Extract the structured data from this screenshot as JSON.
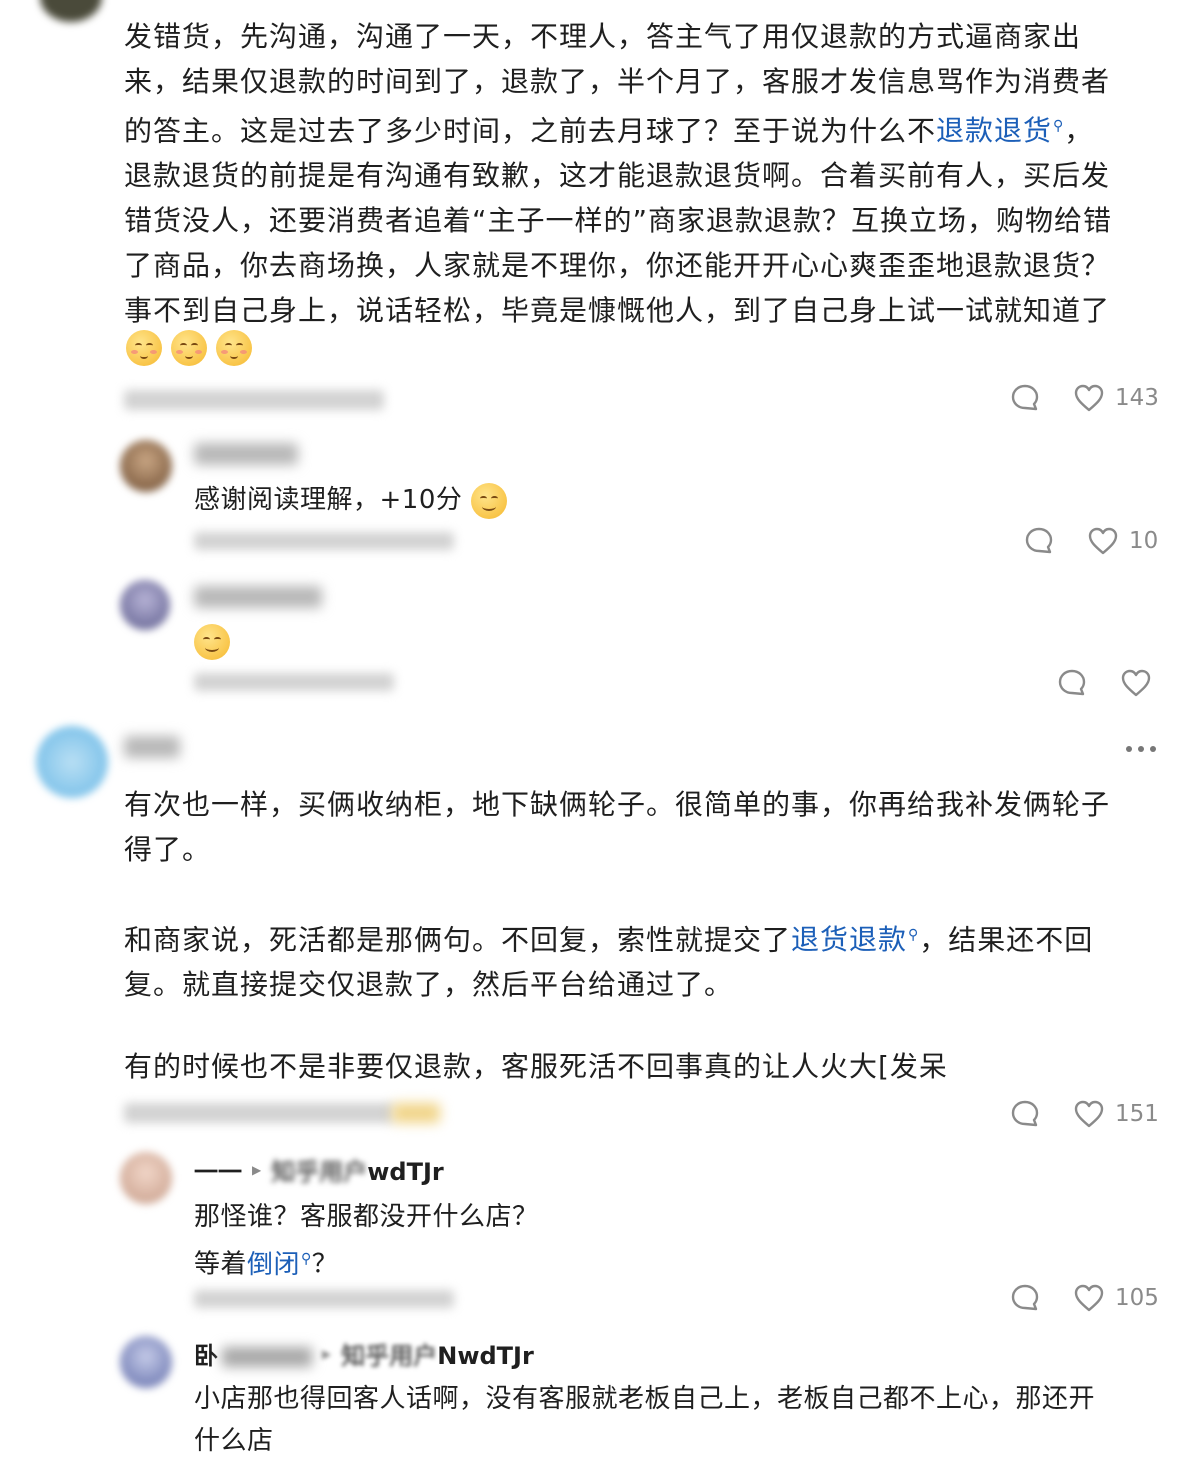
{
  "comments": [
    {
      "text_segments": [
        {
          "t": "发错货，先沟通，沟通了一天，不理人，答主气了用仅退款的方式逼商家出\n来，结果仅退款的时间到了，退款了，半个月了，客服才发信息骂作为消费者\n的答主。这是过去了多少时间，之前去月球了？至于说为什么不"
        },
        {
          "t": "退款退货",
          "link": true
        },
        {
          "t": "，\n退款退货的前提是有沟通有致歉，这才能退款退货啊。合着买前有人，买后发\n错货没人，还要消费者追着“主子一样的”商家退款退款？互换立场，购物给错\n了商品，你去商场换，人家就是不理你，你还能开开心心爽歪歪地退款退货？\n事不到自己身上，说话轻松，毕竟是慷慨他人，到了自己身上试一试就知道了"
        }
      ],
      "like_count": "143",
      "replies": [
        {
          "text": "感谢阅读理解，+10分",
          "meta_partial": "2022 12 03 · 广东",
          "like_count": "10"
        },
        {
          "text": "",
          "meta_partial": "2 5 7 · 广西",
          "like_count": ""
        }
      ]
    },
    {
      "text_para1": "有次也一样，买俩收纳柜，地下缺俩轮子。很简单的事，你再给我补发俩轮子\n得了。",
      "text_para2_a": "和商家说，死活都是那俩句。不回复，索性就提交了",
      "text_para2_link": "退货退款",
      "text_para2_b": "，结果还不回\n复。就直接提交仅退款了，然后平台给通过了。",
      "text_para3": "有的时候也不是非要仅退款，客服死活不回事真的让人火大[发呆",
      "like_count": "151",
      "replies": [
        {
          "author_prefix": "一一",
          "reply_to_visible": "知乎用户",
          "reply_to_suffix": "wdTJr",
          "text_line1": "那怪谁？客服都没开什么店？",
          "text_line2_a": "等着",
          "text_line2_link": "倒闭",
          "text_line2_b": "？",
          "like_count": "105"
        },
        {
          "author_prefix": "卧",
          "reply_to_visible": "知乎用户",
          "reply_to_suffix": "NwdTJr",
          "text": "小店那也得回客人话啊，没有客服就老板自己上，老板自己都不上心，那还开\n什么店"
        }
      ]
    }
  ],
  "icons": [
    "comment-icon",
    "heart-icon",
    "more-icon",
    "emoji-shy",
    "emoji-grin",
    "emoji-cry-laugh"
  ],
  "colors": {
    "link": "#1c5fb8",
    "meta": "#8a8a8a",
    "text": "#1f1f1f"
  }
}
